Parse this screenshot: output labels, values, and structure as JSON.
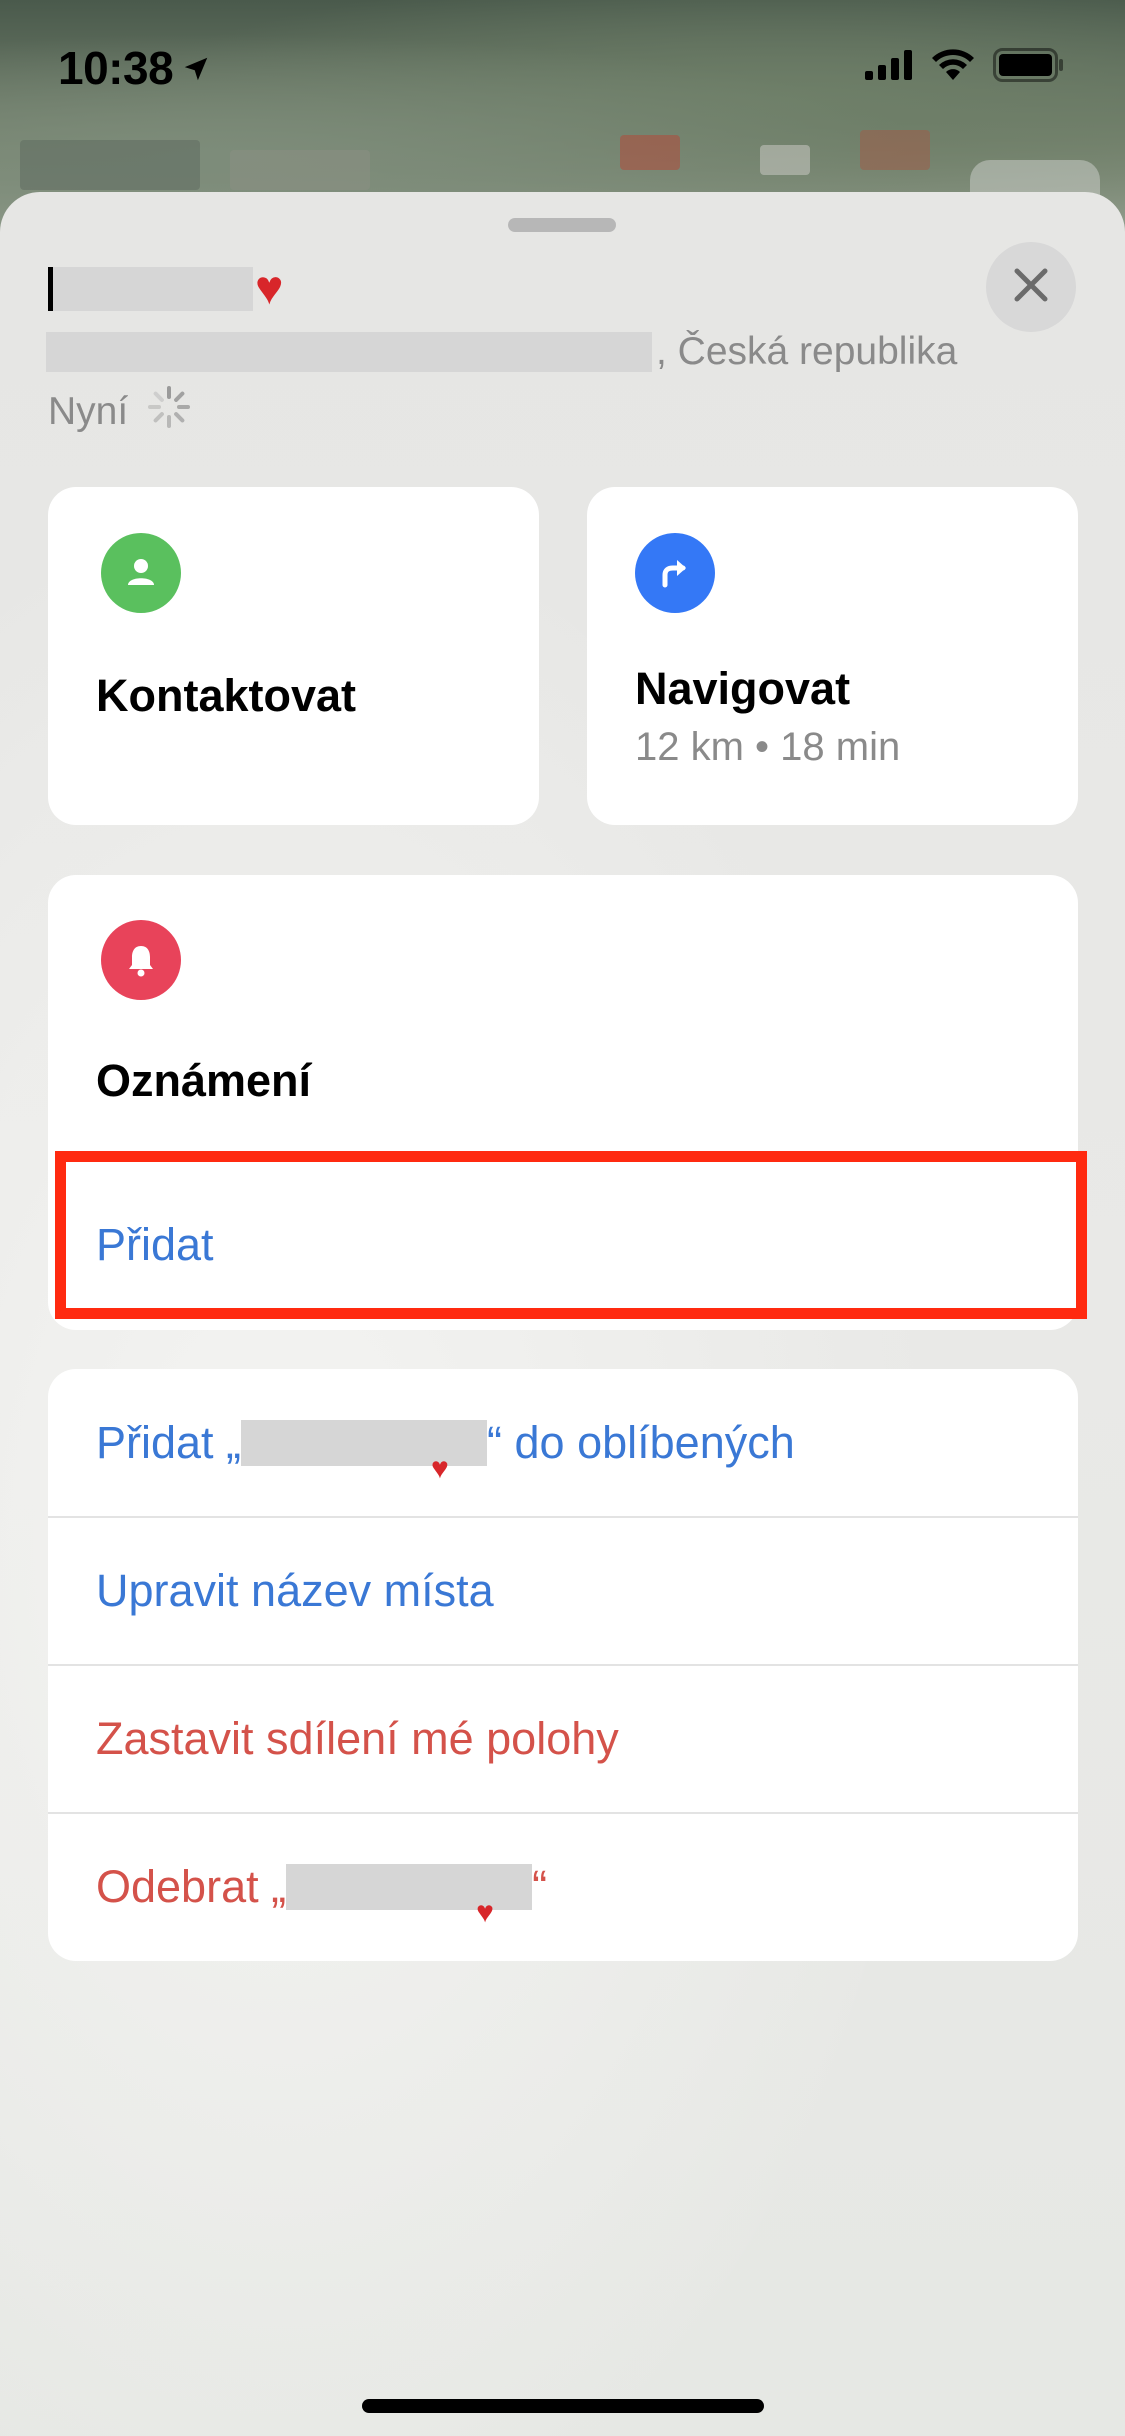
{
  "status_bar": {
    "time": "10:38",
    "location_icon": "location-arrow-icon",
    "signal_icon": "cellular-signal-icon",
    "wifi_icon": "wifi-icon",
    "battery_icon": "battery-full-icon"
  },
  "header": {
    "title_suffix": "♥",
    "address_suffix": ", Česká republika",
    "time_label": "Nyní",
    "loading_icon": "activity-spinner-icon",
    "close_icon": "close-icon"
  },
  "actions": {
    "contact": {
      "label": "Kontaktovat",
      "icon": "person-icon",
      "color": "#5ac05e"
    },
    "navigate": {
      "label": "Navigovat",
      "subtitle": "12 km • 18 min",
      "icon": "turn-right-arrow-icon",
      "color": "#3478f6"
    }
  },
  "notifications": {
    "title": "Oznámení",
    "add_label": "Přidat",
    "icon": "bell-icon",
    "color": "#e8435a"
  },
  "list": {
    "add_favorite_prefix": "Přidat „",
    "add_favorite_suffix": "“ do oblíbených",
    "rename": "Upravit název místa",
    "stop_sharing": "Zastavit sdílení mé polohy",
    "remove_prefix": "Odebrat „",
    "remove_suffix": "“"
  },
  "colors": {
    "link_blue": "#3a78d5",
    "destructive_red": "#d4524a",
    "highlight_red": "#ff2a10"
  }
}
